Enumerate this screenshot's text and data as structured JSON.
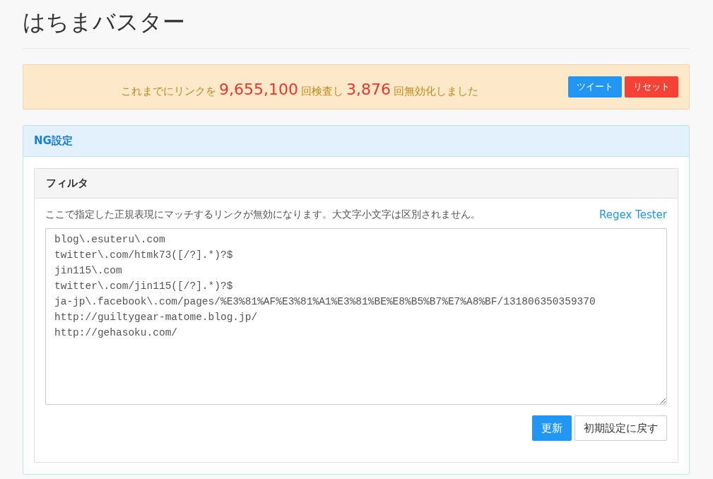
{
  "title": "はちまバスター",
  "stats": {
    "parts": [
      {
        "kind": "text",
        "text": "これまでにリンクを"
      },
      {
        "kind": "count",
        "text": "9,655,100"
      },
      {
        "kind": "text",
        "text": "回検査し"
      },
      {
        "kind": "count",
        "text": "3,876"
      },
      {
        "kind": "text",
        "text": "回無効化しました"
      }
    ],
    "buttons": [
      {
        "kind": "tweet",
        "label": "ツイート"
      },
      {
        "kind": "reset",
        "label": "リセット"
      }
    ]
  },
  "panel": {
    "title": "NG設定",
    "filter": {
      "title": "フィルタ",
      "description": "ここで指定した正規表現にマッチするリンクが無効になります。大文字小文字は区別されません。",
      "link": "Regex Tester",
      "lines": [
        "blog\\.esuteru\\.com",
        "twitter\\.com/htmk73([/?].*)?$",
        "jin115\\.com",
        "twitter\\.com/jin115([/?].*)?$",
        "ja-jp\\.facebook\\.com/pages/%E3%81%AF%E3%81%A1%E3%81%BE%E8%B5%B7%E7%A8%BF/131806350359370",
        "http://guiltygear-matome.blog.jp/",
        "http://gehasoku.com/"
      ],
      "buttons": [
        {
          "kind": "primary",
          "label": "更新"
        },
        {
          "kind": "default",
          "label": "初期設定に戻す"
        }
      ]
    }
  }
}
